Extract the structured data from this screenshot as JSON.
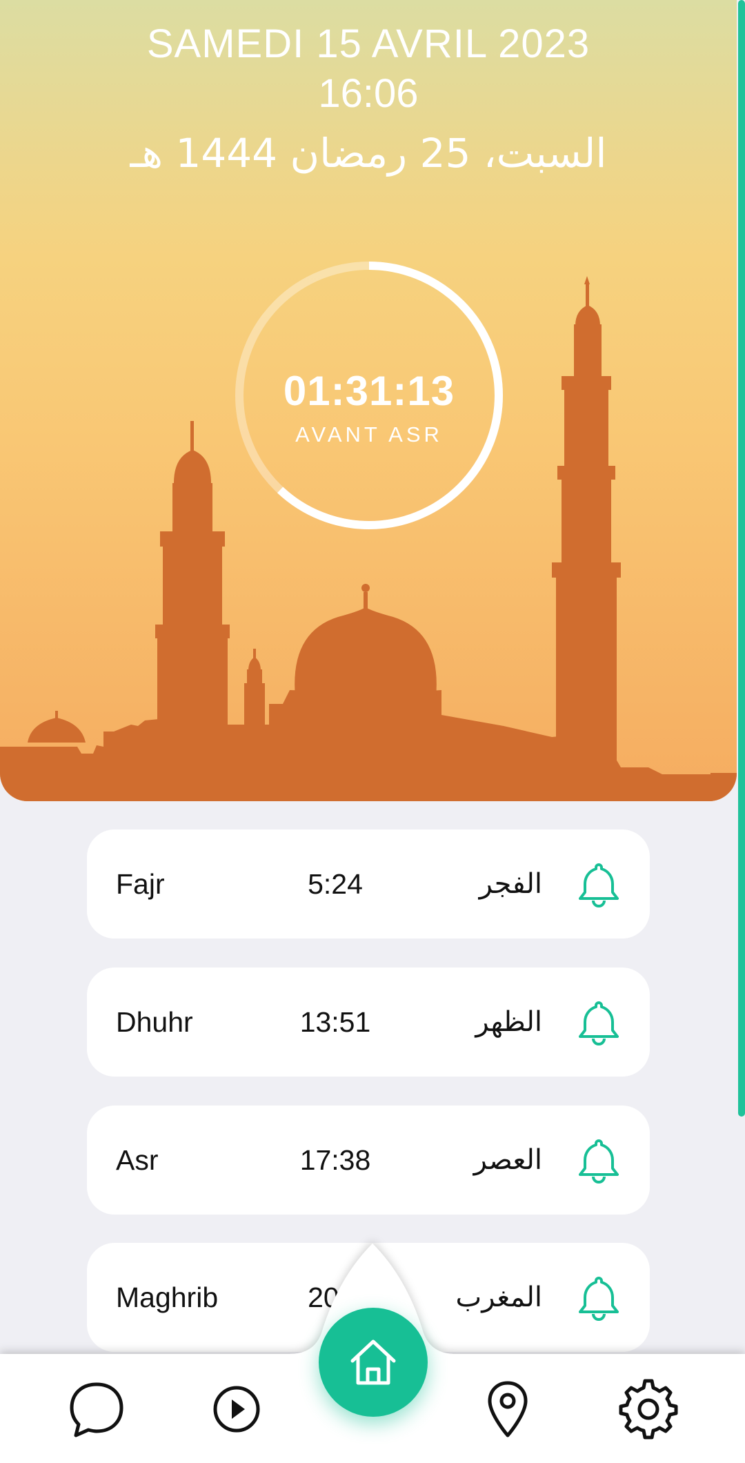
{
  "header": {
    "date_fr": "SAMEDI 15 AVRIL 2023",
    "time": "16:06",
    "date_hijri": "السبت، 25 رمضان 1444 هـ"
  },
  "countdown": {
    "value": "01:31:13",
    "label": "AVANT ASR",
    "progress_fraction": 0.62
  },
  "prayers": [
    {
      "name": "Fajr",
      "time": "5:24",
      "arabic": "الفجر",
      "icon": "bell-icon"
    },
    {
      "name": "Dhuhr",
      "time": "13:51",
      "arabic": "الظهر",
      "icon": "bell-icon"
    },
    {
      "name": "Asr",
      "time": "17:38",
      "arabic": "العصر",
      "icon": "bell-icon"
    },
    {
      "name": "Maghrib",
      "time": "20:4",
      "arabic": "المغرب",
      "icon": "bell-icon"
    }
  ],
  "nav": {
    "items": [
      "chat-icon",
      "play-icon",
      "home-icon",
      "location-pin-icon",
      "settings-gear-icon"
    ],
    "active": "home-icon"
  },
  "colors": {
    "accent": "#17bf95",
    "silhouette": "#d06d2f",
    "sky_top": "#dcdda2",
    "sky_bottom": "#f5ac60",
    "background": "#efeff4"
  }
}
